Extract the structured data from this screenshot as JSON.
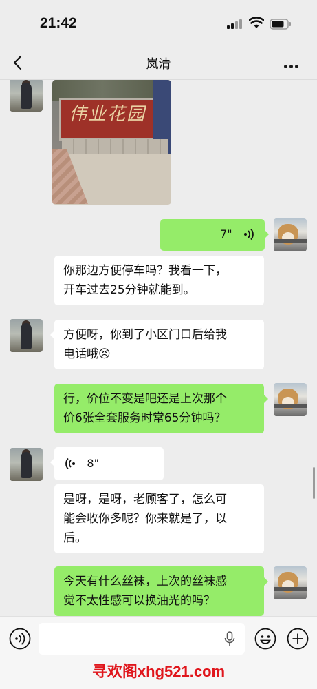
{
  "status_bar": {
    "time": "21:42"
  },
  "nav": {
    "title": "岚清"
  },
  "messages": {
    "photo": {
      "sign_text": "伟业花园"
    },
    "voice_me": {
      "duration": "7\""
    },
    "msg1": {
      "line1": "你那边方便停车吗？我看一下，",
      "line2": "开车过去25分钟就能到。"
    },
    "msg2": {
      "line1": "方便呀，你到了小区门口后给我",
      "line2": "电话哦",
      "emoji": "😣"
    },
    "msg3": {
      "line1": "行，价位不变是吧还是上次那个",
      "line2": "价6张全套服务时常65分钟吗？"
    },
    "voice_her": {
      "duration": "8\""
    },
    "msg4": {
      "line1": "是呀，是呀，老顾客了，怎么可",
      "line2": "能会收你多呢？你来就是了，以",
      "line3": "后。"
    },
    "msg5": {
      "line1": "今天有什么丝袜，上次的丝袜感",
      "line2": "觉不太性感可以换油光的吗？"
    }
  },
  "input_bar": {
    "watermark": "寻欢阁xhg521.com"
  },
  "colors": {
    "bg": "#ededed",
    "green_bubble": "#95ec69",
    "white_bubble": "#ffffff",
    "watermark": "#e0161c"
  },
  "icons": [
    "signal-icon",
    "wifi-icon",
    "battery-icon",
    "back-arrow-icon",
    "more-dots-icon",
    "voice-wave-icon",
    "mic-icon",
    "emoji-icon",
    "plus-icon",
    "voice-toggle-icon"
  ]
}
